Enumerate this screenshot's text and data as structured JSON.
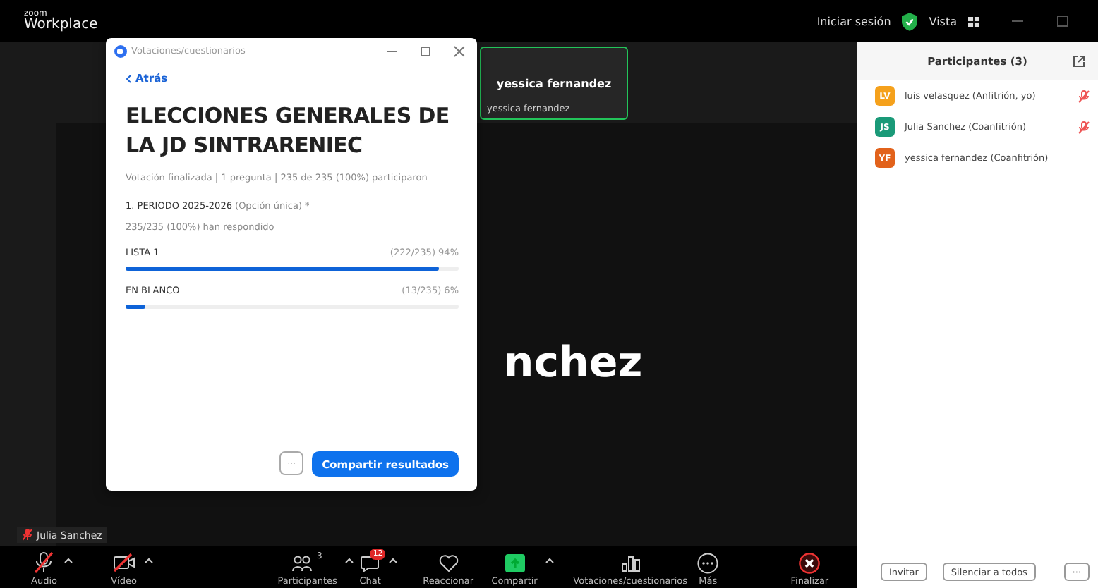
{
  "app": {
    "brand_small": "zoom",
    "brand": "Workplace"
  },
  "top_bar": {
    "sign_in": "Iniciar sesión",
    "view": "Vista"
  },
  "thumbnail": {
    "title": "yessica fernandez",
    "label": "yessica fernandez",
    "speaking": true
  },
  "speaker": {
    "name": "nchez",
    "label": "Julia Sanchez",
    "muted": true
  },
  "dialog": {
    "title": "Votaciones/cuestionarios",
    "back": "Atrás",
    "heading": "ELECCIONES GENERALES DE LA JD SINTRARENIEC",
    "meta": "Votación finalizada | 1 pregunta | 235 de 235 (100%) participaron",
    "question": "1. PERIODO 2025-2026",
    "question_type": "(Opción única) *",
    "responded": "235/235 (100%) han respondido",
    "options": [
      {
        "label": "LISTA 1",
        "result": "(222/235) 94%",
        "level": 0.94
      },
      {
        "label": "EN BLANCO",
        "result": "(13/235) 6%",
        "level": 0.06
      }
    ],
    "more": "···",
    "share": "Compartir resultados"
  },
  "toolbar": [
    {
      "kind": "audio",
      "label": "Audio",
      "caret": true
    },
    {
      "kind": "video",
      "label": "Vídeo",
      "caret": true
    },
    {
      "kind": "participants",
      "label": "Participantes",
      "caret": true,
      "count": "3"
    },
    {
      "kind": "chat",
      "label": "Chat",
      "caret": true,
      "badge": "12"
    },
    {
      "kind": "react",
      "label": "Reaccionar",
      "caret": false
    },
    {
      "kind": "share",
      "label": "Compartir",
      "caret": true
    },
    {
      "kind": "polls",
      "label": "Votaciones/cuestionarios",
      "caret": false
    },
    {
      "kind": "more",
      "label": "Más",
      "caret": false
    },
    {
      "kind": "end",
      "label": "Finalizar",
      "caret": false
    }
  ],
  "participants": {
    "title": "Participantes (3)",
    "items": [
      {
        "initials": "LV",
        "name": "luis velasquez (Anfitrión, yo)",
        "color": "#f5a11c",
        "muted": true
      },
      {
        "initials": "JS",
        "name": "Julia Sanchez (Coanfitrión)",
        "color": "#1a9a78",
        "muted": true
      },
      {
        "initials": "YF",
        "name": "yessica fernandez (Coanfitrión)",
        "color": "#e2621b",
        "muted": false
      }
    ],
    "buttons": [
      "Invitar",
      "Silenciar a todos",
      "···"
    ]
  }
}
